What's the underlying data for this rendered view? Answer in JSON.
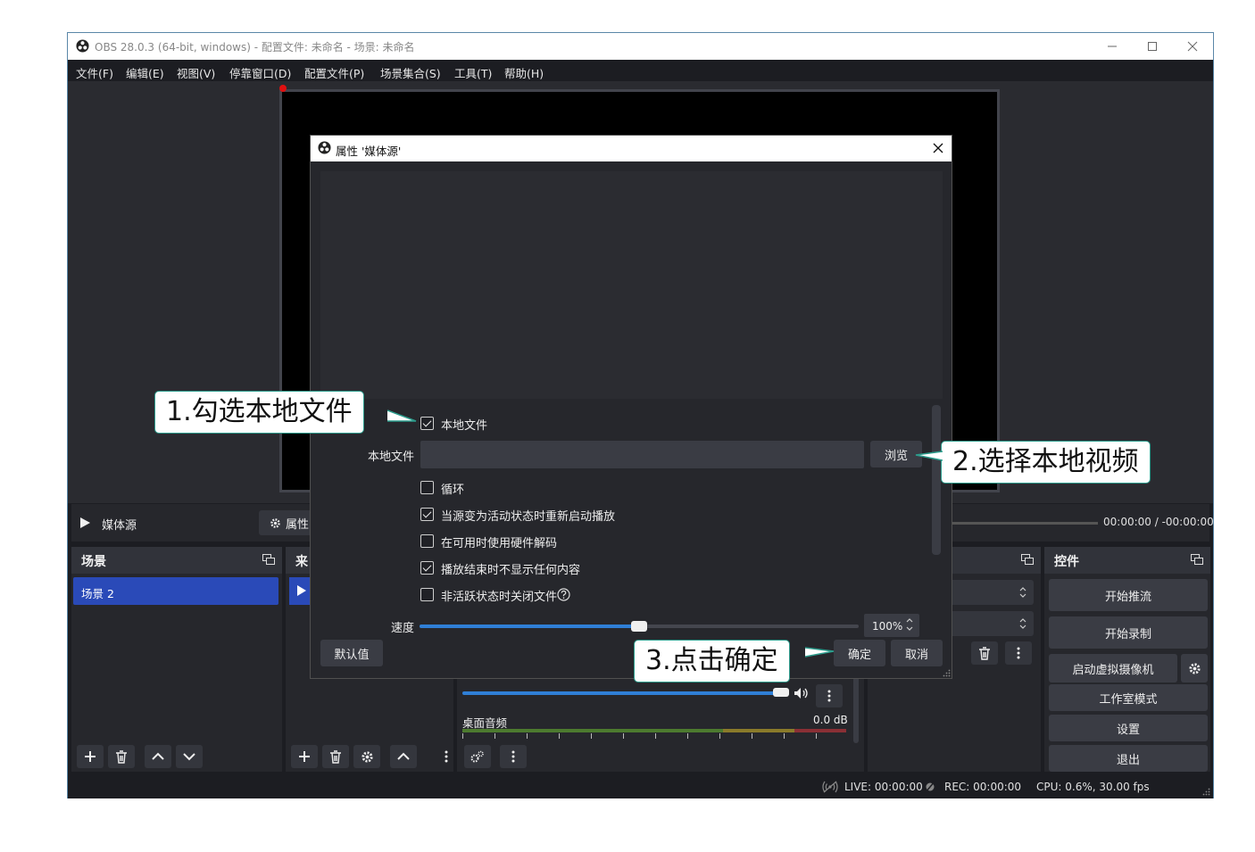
{
  "window": {
    "title": "OBS 28.0.3 (64-bit, windows) - 配置文件: 未命名 - 场景: 未命名",
    "menu": [
      "文件(F)",
      "编辑(E)",
      "视图(V)",
      "停靠窗口(D)",
      "配置文件(P)",
      "场景集合(S)",
      "工具(T)",
      "帮助(H)"
    ]
  },
  "source_toolbar": {
    "source_name": "媒体源",
    "properties_label": "属性",
    "time": "00:00:00  /  -00:00:00"
  },
  "docks": {
    "scenes": {
      "title": "场景",
      "items": [
        "场景 2"
      ]
    },
    "sources": {
      "title": "来"
    },
    "mixer": {
      "track_name": "桌面音频",
      "track_db": "0.0 dB"
    },
    "controls": {
      "title": "控件",
      "buttons": [
        "开始推流",
        "开始录制",
        "启动虚拟摄像机",
        "工作室模式",
        "设置",
        "退出"
      ]
    }
  },
  "status": {
    "live": "LIVE: 00:00:00",
    "rec": "REC: 00:00:00",
    "cpu": "CPU: 0.6%, 30.00 fps"
  },
  "dialog": {
    "title": "属性 '媒体源'",
    "local_file_checkbox": "本地文件",
    "local_file_label": "本地文件",
    "local_file_value": "",
    "browse_label": "浏览",
    "options": [
      {
        "label": "循环",
        "checked": false
      },
      {
        "label": "当源变为活动状态时重新启动播放",
        "checked": true
      },
      {
        "label": "在可用时使用硬件解码",
        "checked": false
      },
      {
        "label": "播放结束时不显示任何内容",
        "checked": true
      },
      {
        "label": "非活跃状态时关闭文件",
        "checked": false
      }
    ],
    "speed_label": "速度",
    "speed_value": "100%",
    "speed_fraction": 0.5,
    "defaults_label": "默认值",
    "ok_label": "确定",
    "cancel_label": "取消"
  },
  "callouts": {
    "step1": "1.勾选本地文件",
    "step2": "2.选择本地视频",
    "step3": "3.点击确定"
  },
  "colors": {
    "accent_blue": "#2a4ab8",
    "slider_blue": "#2f7fd6",
    "callout_border": "#2c9c8c"
  }
}
